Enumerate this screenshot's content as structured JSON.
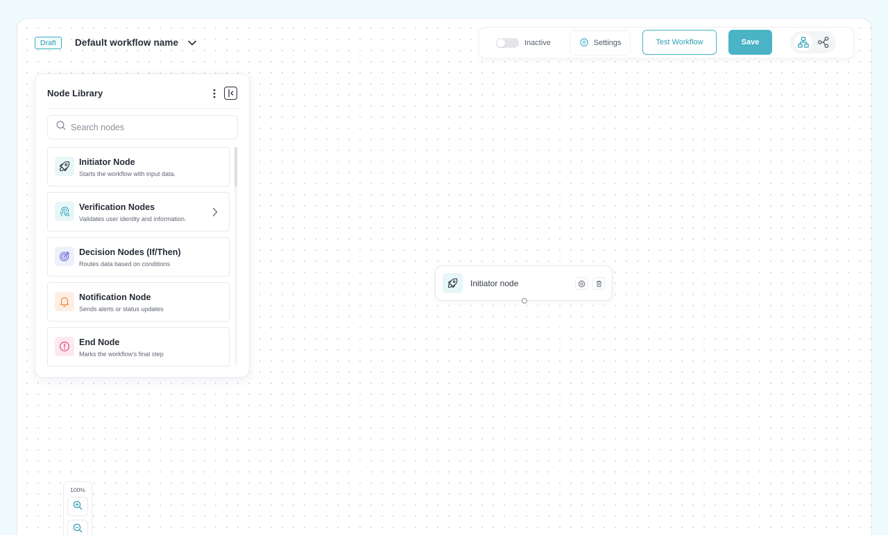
{
  "header": {
    "status_badge": "Draft",
    "workflow_name": "Default workflow name"
  },
  "toolbar": {
    "toggle_label": "Inactive",
    "toggle_on": false,
    "settings_label": "Settings",
    "test_label": "Test Workflow",
    "save_label": "Save",
    "views": [
      "tree-view-icon",
      "graph-view-icon"
    ]
  },
  "library": {
    "title": "Node Library",
    "search_placeholder": "Search nodes",
    "items": [
      {
        "name": "Initiator Node",
        "desc": "Starts the workflow with input data.",
        "icon": "rocket-icon",
        "color": "#e8f6f8",
        "has_submenu": false
      },
      {
        "name": "Verification Nodes",
        "desc": "Validates user identity and information.",
        "icon": "fingerprint-icon",
        "color": "#e8f6f8",
        "has_submenu": true
      },
      {
        "name": "Decision Nodes (If/Then)",
        "desc": "Routes data based on conditions",
        "icon": "target-icon",
        "color": "#eef0fb",
        "has_submenu": false
      },
      {
        "name": "Notification Node",
        "desc": "Sends alerts or status updates",
        "icon": "bell-icon",
        "color": "#fdeee4",
        "has_submenu": false
      },
      {
        "name": "End Node",
        "desc": "Marks the workflow's final step",
        "icon": "alert-circle-icon",
        "color": "#fde8f1",
        "has_submenu": false
      }
    ]
  },
  "canvas": {
    "node_label": "Initiator node"
  },
  "zoom": {
    "level": "100%"
  },
  "colors": {
    "accent": "#4ab3c6",
    "accent_text": "#2f9fb5",
    "background": "#eefafb"
  }
}
